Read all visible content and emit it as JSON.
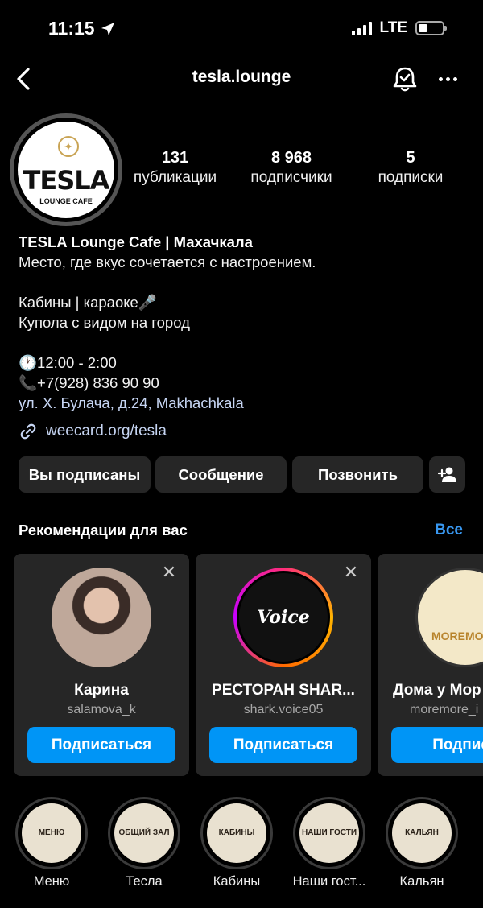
{
  "status_bar": {
    "time": "11:15",
    "network": "LTE"
  },
  "nav": {
    "title": "tesla.lounge"
  },
  "profile": {
    "avatar_text": "TESLA",
    "avatar_subtext": "LOUNGE CAFE",
    "stats": [
      {
        "value": "131",
        "label": "публикации"
      },
      {
        "value": "8 968",
        "label": "подписчики"
      },
      {
        "value": "5",
        "label": "подписки"
      }
    ],
    "bio": {
      "name": "TESLA Lounge Cafe | Махачкала",
      "line1": "Место, где вкус сочетается с настроением.",
      "line2": "Кабины | караоке🎤",
      "line3": "Купола с видом на город",
      "hours": "🕐12:00 - 2:00",
      "phone": "📞+7(928) 836 90 90",
      "address": "ул. Х. Булача, д.24, Makhachkala"
    },
    "link": "weecard.org/tesla"
  },
  "actions": {
    "following": "Вы подписаны",
    "message": "Сообщение",
    "call": "Позвонить"
  },
  "recommendations": {
    "title": "Рекомендации для вас",
    "see_all": "Все",
    "cards": [
      {
        "name": "Карина",
        "username": "salamova_k",
        "button": "Подписаться"
      },
      {
        "name": "РЕСТОРАН SHAR...",
        "username": "shark.voice05",
        "button": "Подписаться",
        "avatar_text": "Voice"
      },
      {
        "name": "Дома у Мор",
        "username": "moremore_i",
        "button": "Подписа",
        "avatar_text": "MOREMORE"
      }
    ]
  },
  "highlights": [
    {
      "label": "Меню",
      "cover": "МЕНЮ"
    },
    {
      "label": "Тесла",
      "cover": "ОБЩИЙ ЗАЛ"
    },
    {
      "label": "Кабины",
      "cover": "КАБИНЫ"
    },
    {
      "label": "Наши гост...",
      "cover": "НАШИ ГОСТИ"
    },
    {
      "label": "Кальян",
      "cover": "КАЛЬЯН"
    }
  ],
  "colors": {
    "background": "#000000",
    "button": "#262626",
    "accent": "#0095f6",
    "link": "#c6d5f3"
  }
}
